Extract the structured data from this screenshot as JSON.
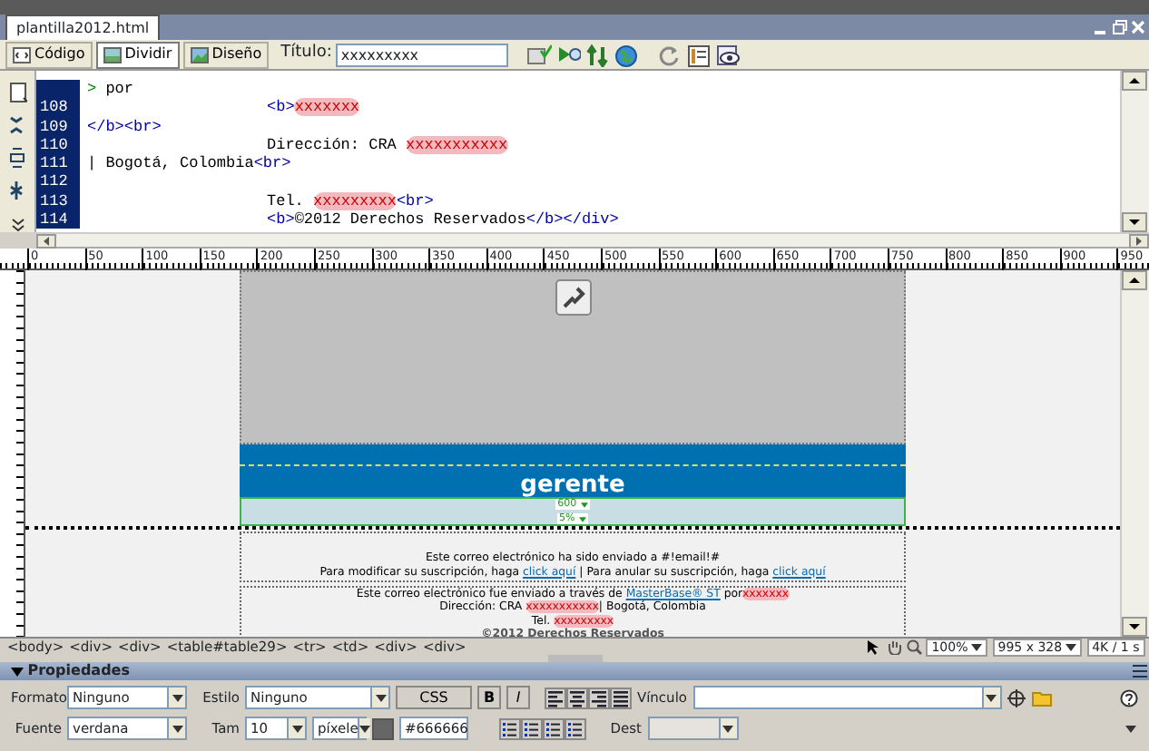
{
  "document_tab": {
    "label": "plantilla2012.html",
    "selected": true
  },
  "view_buttons": [
    {
      "label": "Código",
      "selected": false
    },
    {
      "label": "Dividir",
      "selected": true
    },
    {
      "label": "Diseño",
      "selected": false
    }
  ],
  "title_field": {
    "label": "Título:",
    "value": "xxxxxxxxx"
  },
  "code_lines": [
    {
      "left": [
        {
          "kind": "symbol",
          "text": ">"
        },
        {
          "kind": "text",
          "text": " por"
        }
      ]
    },
    {
      "number": "108",
      "right": [
        {
          "kind": "tag",
          "text": "<b>"
        },
        {
          "kind": "redacted",
          "text": "xxxxxxx"
        }
      ]
    },
    {
      "number": "109",
      "left": [
        {
          "kind": "tag",
          "text": "</b><br>"
        }
      ]
    },
    {
      "number": "110",
      "right": [
        {
          "kind": "text",
          "text": "Dirección: CRA "
        },
        {
          "kind": "redacted",
          "text": "xxxxxxxxxxx"
        }
      ]
    },
    {
      "number": "111",
      "left": [
        {
          "kind": "text",
          "text": "| Bogotá, Colombia"
        },
        {
          "kind": "tag",
          "text": "<br>"
        }
      ]
    },
    {
      "number": "112"
    },
    {
      "number": "113",
      "right": [
        {
          "kind": "text",
          "text": "Tel. "
        },
        {
          "kind": "redacted",
          "text": "xxxxxxxxx"
        },
        {
          "kind": "tag",
          "text": "<br>"
        }
      ]
    },
    {
      "number": "114",
      "right": [
        {
          "kind": "tag",
          "text": "<b>"
        },
        {
          "kind": "text",
          "text": "©2012 Derechos Reservados"
        },
        {
          "kind": "tag",
          "text": "</b></div>"
        }
      ]
    }
  ],
  "ruler_labels": [
    "0",
    "50",
    "100",
    "150",
    "200",
    "250",
    "300",
    "350",
    "400",
    "450",
    "500",
    "550",
    "600",
    "650",
    "700",
    "750",
    "800",
    "850",
    "900",
    "950"
  ],
  "design": {
    "banner_text": "gerente",
    "width_markers": [
      "600",
      "5%"
    ],
    "footer_lines": [
      [
        {
          "kind": "text",
          "text": "Este correo electrónico ha sido enviado a #!email!#"
        }
      ],
      [
        {
          "kind": "text",
          "text": "Para modificar su suscripción, haga "
        },
        {
          "kind": "link",
          "text": "click aquí"
        },
        {
          "kind": "text",
          "text": " | Para anular su suscripción, haga "
        },
        {
          "kind": "link",
          "text": "click aquí"
        }
      ]
    ],
    "credit_lines": [
      [
        {
          "kind": "text",
          "text": "Este correo electrónico fue enviado a través de "
        },
        {
          "kind": "link",
          "text": "MasterBase® ST"
        },
        {
          "kind": "text",
          "text": " por"
        },
        {
          "kind": "redacted",
          "text": "xxxxxxx"
        }
      ],
      [
        {
          "kind": "text",
          "text": "Dirección: CRA "
        },
        {
          "kind": "redacted",
          "text": "xxxxxxxxxxx"
        },
        {
          "kind": "text",
          "text": "| Bogotá, Colombia"
        }
      ],
      [
        {
          "kind": "text",
          "text": "Tel. "
        },
        {
          "kind": "redacted",
          "text": "xxxxxxxxx"
        }
      ],
      [
        {
          "kind": "bold",
          "text": "©2012 Derechos Reservados"
        }
      ]
    ]
  },
  "tag_selector": [
    "<body>",
    "<div>",
    "<div>",
    "<table#table29>",
    "<tr>",
    "<td>",
    "<div>",
    "<div>"
  ],
  "status": {
    "zoom": "100%",
    "window_size": "995 x 328",
    "download": "4K / 1 s"
  },
  "properties": {
    "title": "Propiedades",
    "expanded": true,
    "format": {
      "label": "Formato",
      "value": "Ninguno"
    },
    "style": {
      "label": "Estilo",
      "value": "Ninguno"
    },
    "css_button": "CSS",
    "bold_button": "B",
    "italic_button": "I",
    "link": {
      "label": "Vínculo"
    },
    "font": {
      "label": "Fuente",
      "value": "verdana"
    },
    "size": {
      "label": "Tam",
      "value": "10",
      "unit": "píxele"
    },
    "color": {
      "value": "#666666"
    },
    "target": {
      "label": "Dest",
      "disabled": true
    }
  }
}
